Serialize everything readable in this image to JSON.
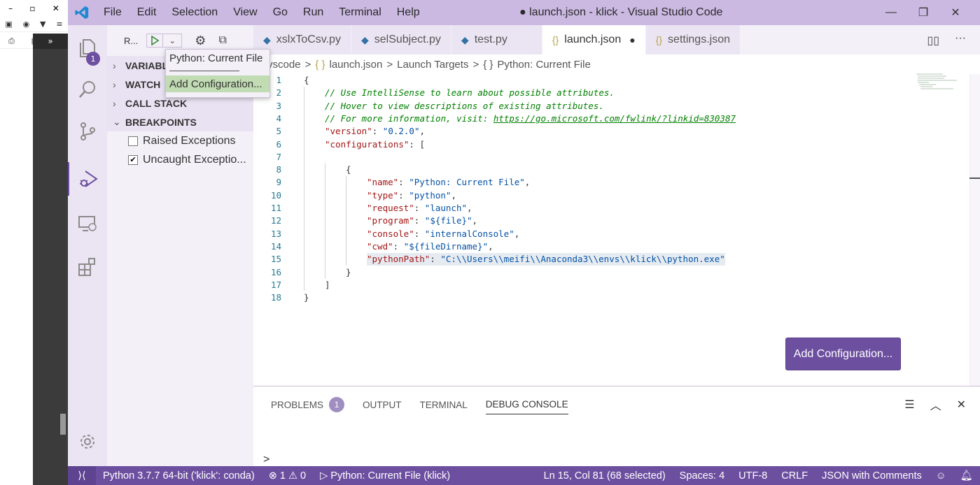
{
  "window": {
    "title": "● launch.json - klick - Visual Studio Code"
  },
  "menu": [
    "File",
    "Edit",
    "Selection",
    "View",
    "Go",
    "Run",
    "Terminal",
    "Help"
  ],
  "activity": {
    "explorer_badge": "1"
  },
  "debug": {
    "config_label": "R...",
    "dropdown": {
      "current": "Python: Current File",
      "add": "Add Configuration..."
    }
  },
  "sidebar": {
    "sections": {
      "variables": "VARIABLES",
      "watch": "WATCH",
      "call_stack": "CALL STACK",
      "breakpoints": "BREAKPOINTS"
    },
    "breakpoints": [
      {
        "label": "Raised Exceptions",
        "checked": false
      },
      {
        "label": "Uncaught Exceptio...",
        "checked": true
      }
    ]
  },
  "tabs": [
    {
      "label": "xslxToCsv.py",
      "icon": "python-icon"
    },
    {
      "label": "selSubject.py",
      "icon": "python-icon"
    },
    {
      "label": "test.py",
      "icon": "python-icon"
    },
    {
      "label": "launch.json",
      "icon": "json-icon",
      "active": true,
      "dirty": "●"
    },
    {
      "label": "settings.json",
      "icon": "json-icon"
    }
  ],
  "breadcrumb": {
    "folder": "vscode",
    "file": "launch.json",
    "section": "Launch Targets",
    "item": "Python: Current File",
    "json_glyph": "{ }",
    "sep": ">"
  },
  "editor": {
    "line_numbers": [
      "1",
      "2",
      "3",
      "4",
      "5",
      "6",
      "7",
      "8",
      "9",
      "10",
      "11",
      "12",
      "13",
      "14",
      "15",
      "16",
      "17",
      "18"
    ],
    "lines": {
      "l1": "{",
      "l2": "// Use IntelliSense to learn about possible attributes.",
      "l3": "// Hover to view descriptions of existing attributes.",
      "l4_prefix": "// For more information, visit: ",
      "l4_link": "https://go.microsoft.com/fwlink/?linkid=830387",
      "l5_key": "\"version\"",
      "l5_val": "\"0.2.0\"",
      "l6_key": "\"configurations\"",
      "l6_rest": ": [",
      "l8": "{",
      "l9_key": "\"name\"",
      "l9_val": "\"Python: Current File\"",
      "l10_key": "\"type\"",
      "l10_val": "\"python\"",
      "l11_key": "\"request\"",
      "l11_val": "\"launch\"",
      "l12_key": "\"program\"",
      "l12_val": "\"${file}\"",
      "l13_key": "\"console\"",
      "l13_val": "\"internalConsole\"",
      "l14_key": "\"cwd\"",
      "l14_val": "\"${fileDirname}\"",
      "l15_key": "\"pythonPath\"",
      "l15_val": "\"C:\\\\Users\\\\meifi\\\\Anaconda3\\\\envs\\\\klick\\\\python.exe\"",
      "l16": "}",
      "l17": "]",
      "l18": "}"
    },
    "add_config_button": "Add Configuration..."
  },
  "panel": {
    "tabs": [
      {
        "label": "PROBLEMS",
        "badge": "1"
      },
      {
        "label": "OUTPUT"
      },
      {
        "label": "TERMINAL"
      },
      {
        "label": "DEBUG CONSOLE",
        "active": true
      }
    ],
    "prompt": ">"
  },
  "statusbar": {
    "interpreter": "Python 3.7.7 64-bit ('klick': conda)",
    "errors": "1",
    "warnings": "0",
    "debug_target": "Python: Current File (klick)",
    "cursor": "Ln 15, Col 81 (68 selected)",
    "spaces": "Spaces: 4",
    "encoding": "UTF-8",
    "eol": "CRLF",
    "language": "JSON with Comments"
  },
  "colors": {
    "accent": "#6d4fa0",
    "titlebar": "#cbb9e2"
  }
}
